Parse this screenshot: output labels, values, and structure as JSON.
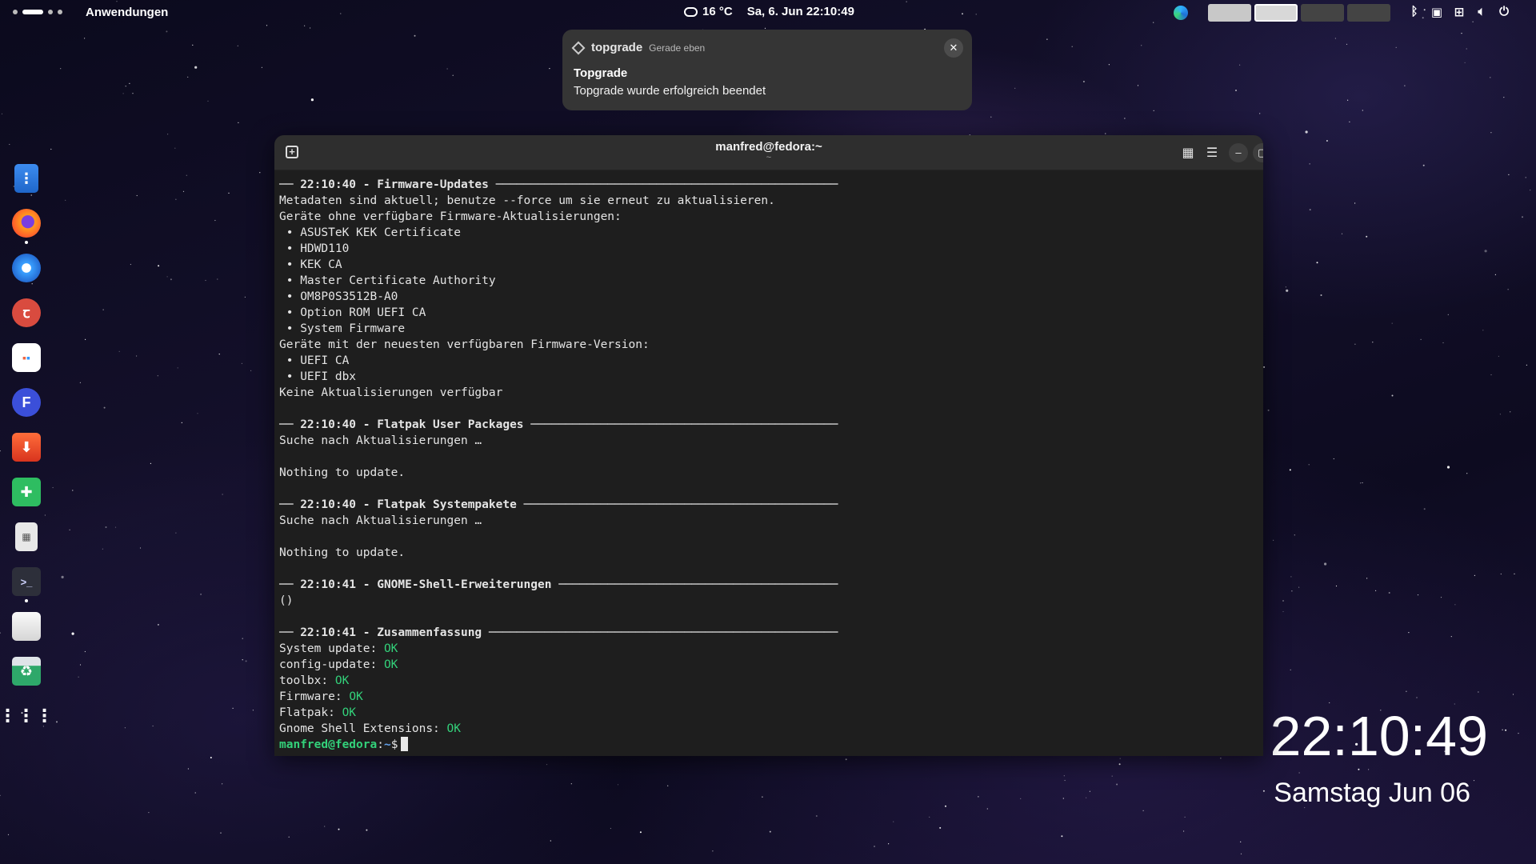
{
  "topbar": {
    "apps_label": "Anwendungen",
    "weather": "16 °C",
    "datetime": "Sa, 6. Jun  22:10:49",
    "tray_icons": [
      "bluetooth-icon",
      "screen-icon",
      "network-icon",
      "volume-icon",
      "power-icon"
    ]
  },
  "dock": {
    "items": [
      "files",
      "firefox",
      "thunderbird",
      "app-red",
      "software-store",
      "fedora-app",
      "video-downloader",
      "extensions",
      "calculator",
      "terminal",
      "blank-app",
      "trash",
      "show-apps"
    ]
  },
  "notification": {
    "app": "topgrade",
    "time": "Gerade eben",
    "title": "Topgrade",
    "body": "Topgrade wurde erfolgreich beendet",
    "close": "✕"
  },
  "window": {
    "title": "manfred@fedora:~",
    "subtitle": "~"
  },
  "terminal": {
    "lines": [
      {
        "text": "── 22:10:40 - Firmware-Updates ─────────────────────────────────────────────────",
        "head": true
      },
      {
        "text": "Metadaten sind aktuell; benutze --force um sie erneut zu aktualisieren."
      },
      {
        "text": "Geräte ohne verfügbare Firmware-Aktualisierungen:"
      },
      {
        "text": " • ASUSTeK KEK Certificate"
      },
      {
        "text": " • HDWD110"
      },
      {
        "text": " • KEK CA"
      },
      {
        "text": " • Master Certificate Authority"
      },
      {
        "text": " • OM8P0S3512B-A0"
      },
      {
        "text": " • Option ROM UEFI CA"
      },
      {
        "text": " • System Firmware"
      },
      {
        "text": "Geräte mit der neuesten verfügbaren Firmware-Version:"
      },
      {
        "text": " • UEFI CA"
      },
      {
        "text": " • UEFI dbx"
      },
      {
        "text": "Keine Aktualisierungen verfügbar"
      },
      {
        "text": ""
      },
      {
        "text": "── 22:10:40 - Flatpak User Packages ────────────────────────────────────────────",
        "head": true
      },
      {
        "text": "Suche nach Aktualisierungen …"
      },
      {
        "text": ""
      },
      {
        "text": "Nothing to update."
      },
      {
        "text": ""
      },
      {
        "text": "── 22:10:40 - Flatpak Systempakete ─────────────────────────────────────────────",
        "head": true
      },
      {
        "text": "Suche nach Aktualisierungen …"
      },
      {
        "text": ""
      },
      {
        "text": "Nothing to update."
      },
      {
        "text": ""
      },
      {
        "text": "── 22:10:41 - GNOME-Shell-Erweiterungen ────────────────────────────────────────",
        "head": true
      },
      {
        "text": "()"
      },
      {
        "text": ""
      },
      {
        "text": "── 22:10:41 - Zusammenfassung ──────────────────────────────────────────────────",
        "head": true
      },
      {
        "text": "System update: ",
        "status": "OK"
      },
      {
        "text": "config-update: ",
        "status": "OK"
      },
      {
        "text": "toolbx: ",
        "status": "OK"
      },
      {
        "text": "Firmware: ",
        "status": "OK"
      },
      {
        "text": "Flatpak: ",
        "status": "OK"
      },
      {
        "text": "Gnome Shell Extensions: ",
        "status": "OK"
      }
    ],
    "prompt_user": "manfred@fedora",
    "prompt_sep": ":",
    "prompt_path": "~",
    "prompt_symbol": "$"
  },
  "desktop_clock": {
    "time": "22:10:49",
    "date": "Samstag Jun 06"
  },
  "colors": {
    "ok": "#33d17a",
    "terminal_bg": "#1e1e1e",
    "headerbar_bg": "#2e2e2e",
    "notification_bg": "#353535"
  }
}
